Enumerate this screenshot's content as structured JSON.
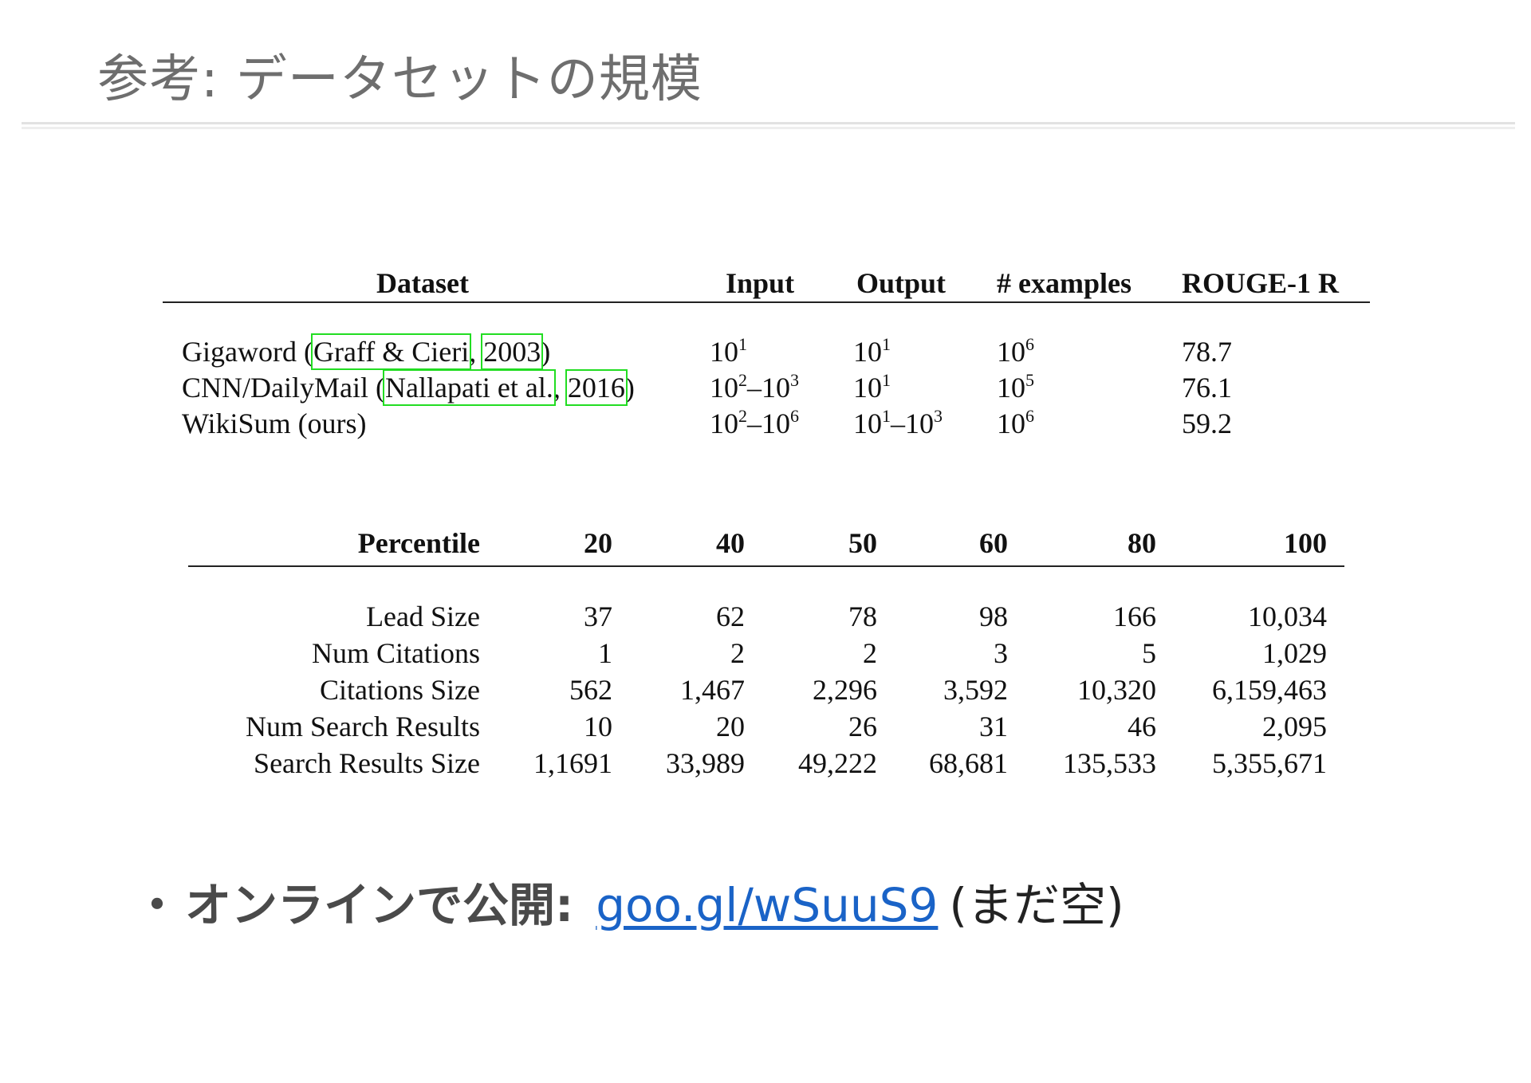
{
  "slide": {
    "title": "参考: データセットの規模"
  },
  "table1": {
    "headers": [
      "Dataset",
      "Input",
      "Output",
      "# examples",
      "ROUGE-1 R"
    ],
    "rows": [
      {
        "name": "Gigaword",
        "cite_author": "Graff & Cieri",
        "cite_year": "2003",
        "input_base": "10",
        "input_exp": "1",
        "input_base2": "",
        "input_exp2": "",
        "output_base": "10",
        "output_exp": "1",
        "output_base2": "",
        "output_exp2": "",
        "examples_base": "10",
        "examples_exp": "6",
        "rouge": "78.7"
      },
      {
        "name": "CNN/DailyMail",
        "cite_author": "Nallapati et al.",
        "cite_year": "2016",
        "input_base": "10",
        "input_exp": "2",
        "input_base2": "–10",
        "input_exp2": "3",
        "output_base": "10",
        "output_exp": "1",
        "output_base2": "",
        "output_exp2": "",
        "examples_base": "10",
        "examples_exp": "5",
        "rouge": "76.1"
      },
      {
        "name": "WikiSum (ours)",
        "input_base": "10",
        "input_exp": "2",
        "input_base2": "–10",
        "input_exp2": "6",
        "output_base": "10",
        "output_exp": "1",
        "output_base2": "–10",
        "output_exp2": "3",
        "examples_base": "10",
        "examples_exp": "6",
        "rouge": "59.2"
      }
    ]
  },
  "table2": {
    "headers": [
      "Percentile",
      "20",
      "40",
      "50",
      "60",
      "80",
      "100"
    ],
    "rows": [
      [
        "Lead Size",
        "37",
        "62",
        "78",
        "98",
        "166",
        "10,034"
      ],
      [
        "Num Citations",
        "1",
        "2",
        "2",
        "3",
        "5",
        "1,029"
      ],
      [
        "Citations Size",
        "562",
        "1,467",
        "2,296",
        "3,592",
        "10,320",
        "6,159,463"
      ],
      [
        "Num Search Results",
        "10",
        "20",
        "26",
        "31",
        "46",
        "2,095"
      ],
      [
        "Search Results Size",
        "1,1691",
        "33,989",
        "49,222",
        "68,681",
        "135,533",
        "5,355,671"
      ]
    ]
  },
  "bullet": {
    "dot": "・",
    "label": "オンラインで公開:",
    "link": "goo.gl/wSuuS9",
    "note": "(まだ空)"
  }
}
